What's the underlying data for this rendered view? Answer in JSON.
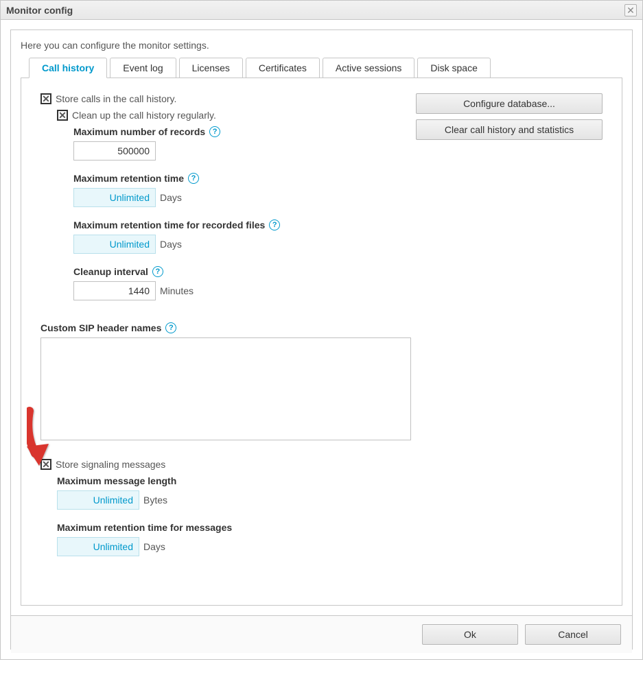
{
  "dialog": {
    "title": "Monitor config",
    "intro": "Here you can configure the monitor settings."
  },
  "tabs": [
    {
      "label": "Call history",
      "active": true
    },
    {
      "label": "Event log",
      "active": false
    },
    {
      "label": "Licenses",
      "active": false
    },
    {
      "label": "Certificates",
      "active": false
    },
    {
      "label": "Active sessions",
      "active": false
    },
    {
      "label": "Disk space",
      "active": false
    }
  ],
  "sideButtons": {
    "configure_db": "Configure database...",
    "clear_history": "Clear call history and statistics"
  },
  "callHistory": {
    "store_calls_label": "Store calls in the call history.",
    "store_calls_checked": true,
    "cleanup_label": "Clean up the call history regularly.",
    "cleanup_checked": true,
    "max_records_label": "Maximum number of records",
    "max_records_value": "500000",
    "max_retention_label": "Maximum retention time",
    "max_retention_value": "Unlimited",
    "max_retention_unit": "Days",
    "max_retention_files_label": "Maximum retention time for recorded files",
    "max_retention_files_value": "Unlimited",
    "max_retention_files_unit": "Days",
    "cleanup_interval_label": "Cleanup interval",
    "cleanup_interval_value": "1440",
    "cleanup_interval_unit": "Minutes",
    "custom_sip_label": "Custom SIP header names",
    "custom_sip_value": ""
  },
  "signaling": {
    "store_label": "Store signaling messages",
    "store_checked": true,
    "max_length_label": "Maximum message length",
    "max_length_value": "Unlimited",
    "max_length_unit": "Bytes",
    "max_retention_label": "Maximum retention time for messages",
    "max_retention_value": "Unlimited",
    "max_retention_unit": "Days"
  },
  "footer": {
    "ok": "Ok",
    "cancel": "Cancel"
  }
}
